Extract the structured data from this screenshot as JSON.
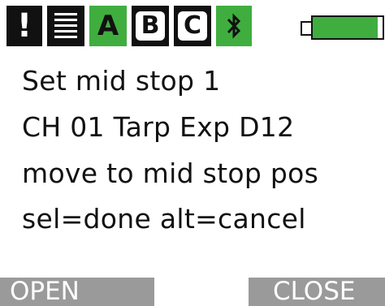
{
  "status_bar": {
    "alert_glyph": "!",
    "alert_icon": "exclamation-icon",
    "menu_icon": "stack-lines-icon",
    "tabs": [
      {
        "label": "A",
        "active": true
      },
      {
        "label": "B",
        "active": false
      },
      {
        "label": "C",
        "active": false
      }
    ],
    "bluetooth_glyph": "∗",
    "bluetooth_icon": "bluetooth-icon",
    "battery_icon": "battery-icon",
    "battery_level": 0.93,
    "colors": {
      "dark": "#111111",
      "green": "#3fae3f"
    }
  },
  "screen": {
    "lines": [
      "Set mid stop 1",
      "CH 01 Tarp Exp D12",
      "move to mid stop pos",
      "sel=done alt=cancel"
    ]
  },
  "softkeys": {
    "left_label": "OPEN",
    "right_label": "CLOSE",
    "color": "#9a9a9a"
  }
}
